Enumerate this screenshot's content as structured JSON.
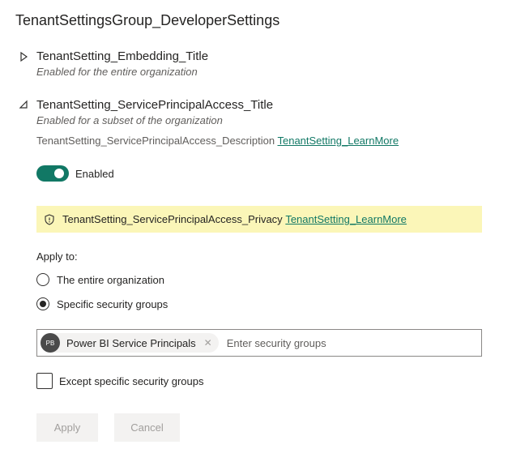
{
  "group": {
    "title": "TenantSettingsGroup_DeveloperSettings"
  },
  "settings": [
    {
      "title": "TenantSetting_Embedding_Title",
      "subtitle": "Enabled for the entire organization",
      "expanded": false
    },
    {
      "title": "TenantSetting_ServicePrincipalAccess_Title",
      "subtitle": "Enabled for a subset of the organization",
      "expanded": true,
      "description": "TenantSetting_ServicePrincipalAccess_Description",
      "learn_more": "TenantSetting_LearnMore",
      "toggle": {
        "label": "Enabled",
        "on": true
      },
      "privacy": {
        "text": "TenantSetting_ServicePrincipalAccess_Privacy",
        "learn_more": "TenantSetting_LearnMore"
      },
      "apply_to": {
        "label": "Apply to:",
        "options": [
          {
            "label": "The entire organization",
            "selected": false
          },
          {
            "label": "Specific security groups",
            "selected": true
          }
        ]
      },
      "security_groups": {
        "chips": [
          {
            "initials": "PB",
            "label": "Power BI Service Principals",
            "remove_glyph": "✕"
          }
        ],
        "placeholder": "Enter security groups"
      },
      "except": {
        "label": "Except specific security groups",
        "checked": false
      }
    }
  ],
  "actions": {
    "apply_label": "Apply",
    "cancel_label": "Cancel"
  },
  "colors": {
    "accent": "#117865",
    "banner_bg": "#fbf6b8",
    "disabled_bg": "#f3f2f1",
    "disabled_text": "#a19f9d"
  },
  "icons": {
    "collapsed_caret": "caret-right-icon",
    "expanded_caret": "caret-down-icon",
    "privacy": "shield-icon",
    "chip_remove": "close-icon"
  }
}
